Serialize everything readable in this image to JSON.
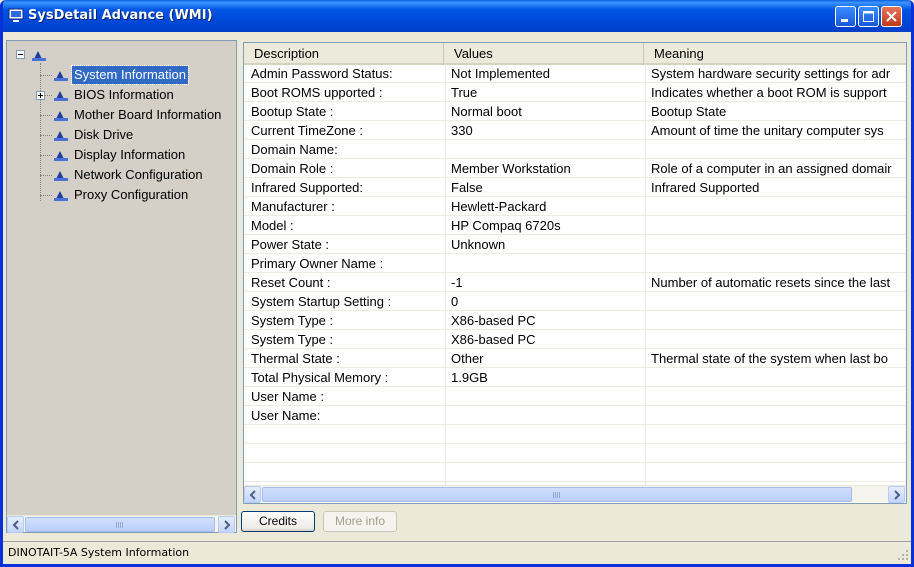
{
  "window": {
    "title": "SysDetail Advance (WMI)"
  },
  "tree": {
    "items": [
      {
        "label": "System Information",
        "selected": true,
        "expandable": false
      },
      {
        "label": "BIOS Information",
        "selected": false,
        "expandable": true
      },
      {
        "label": "Mother Board Information",
        "selected": false,
        "expandable": false
      },
      {
        "label": "Disk Drive",
        "selected": false,
        "expandable": false
      },
      {
        "label": "Display Information",
        "selected": false,
        "expandable": false
      },
      {
        "label": "Network Configuration",
        "selected": false,
        "expandable": false
      },
      {
        "label": "Proxy Configuration",
        "selected": false,
        "expandable": false
      }
    ]
  },
  "table": {
    "columns": [
      "Description",
      "Values",
      "Meaning"
    ],
    "rows": [
      [
        "Admin Password Status:",
        "Not Implemented",
        "System hardware security settings for adr"
      ],
      [
        "Boot ROMS upported :",
        "True",
        " Indicates whether a boot ROM is support"
      ],
      [
        "Bootup State :",
        "Normal boot",
        "Bootup State"
      ],
      [
        "Current TimeZone :",
        "330",
        "Amount of time the unitary computer sys"
      ],
      [
        "Domain Name:",
        "",
        ""
      ],
      [
        "Domain Role :",
        "Member Workstation",
        "Role of a computer in an assigned domair"
      ],
      [
        "Infrared Supported:",
        "False",
        "Infrared Supported"
      ],
      [
        "Manufacturer :",
        "Hewlett-Packard",
        ""
      ],
      [
        "Model :",
        "HP Compaq 6720s",
        ""
      ],
      [
        "Power State :",
        "Unknown",
        ""
      ],
      [
        "Primary Owner Name :",
        "",
        ""
      ],
      [
        "Reset Count :",
        "-1",
        "Number of automatic resets since the last"
      ],
      [
        "System Startup Setting :",
        "0",
        ""
      ],
      [
        "System Type :",
        "X86-based PC",
        ""
      ],
      [
        "System Type :",
        "X86-based PC",
        ""
      ],
      [
        "Thermal State :",
        "Other",
        "Thermal state of the system when last bo"
      ],
      [
        "Total Physical Memory :",
        "1.9GB",
        ""
      ],
      [
        "User Name :",
        "",
        ""
      ],
      [
        "User Name:",
        "",
        ""
      ],
      [
        "",
        "",
        ""
      ],
      [
        "",
        "",
        ""
      ],
      [
        "",
        "",
        ""
      ]
    ]
  },
  "buttons": {
    "credits": "Credits",
    "more_info": "More info"
  },
  "status": {
    "text": "DINOTAIT-5A  System Information"
  },
  "colors": {
    "title_bar": "#0055E5",
    "selection": "#316AC5",
    "face": "#ECE9D8",
    "tree_bg": "#D4D0C8"
  }
}
